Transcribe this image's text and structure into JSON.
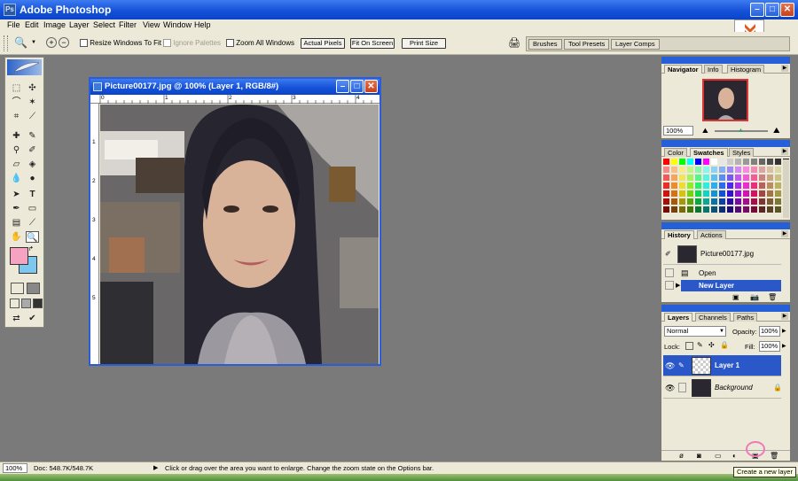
{
  "app": {
    "title": "Adobe Photoshop"
  },
  "menu": [
    "File",
    "Edit",
    "Image",
    "Layer",
    "Select",
    "Filter",
    "View",
    "Window",
    "Help"
  ],
  "options": {
    "resize_windows": "Resize Windows To Fit",
    "ignore_palettes": "Ignore Palettes",
    "zoom_all": "Zoom All Windows",
    "actual_pixels": "Actual Pixels",
    "fit_on_screen": "Fit On Screen",
    "print_size": "Print Size",
    "well_tabs": [
      "Brushes",
      "Tool Presets",
      "Layer Comps"
    ]
  },
  "document": {
    "title": "Picture00177.jpg @ 100% (Layer 1, RGB/8#)",
    "ruler_h": [
      "0",
      "1",
      "2",
      "3",
      "4"
    ],
    "ruler_v": [
      "1",
      "2",
      "3",
      "4",
      "5"
    ]
  },
  "navigator": {
    "tabs": [
      "Navigator",
      "Info",
      "Histogram"
    ],
    "zoom": "100%"
  },
  "color_panel": {
    "tabs": [
      "Color",
      "Swatches",
      "Styles"
    ]
  },
  "history": {
    "tabs": [
      "History",
      "Actions"
    ],
    "snapshot": "Picture00177.jpg",
    "items": [
      "Open",
      "New Layer"
    ]
  },
  "layers": {
    "tabs": [
      "Layers",
      "Channels",
      "Paths"
    ],
    "blend_mode": "Normal",
    "opacity_label": "Opacity:",
    "opacity": "100%",
    "lock_label": "Lock:",
    "fill_label": "Fill:",
    "fill": "100%",
    "items": [
      "Layer 1",
      "Background"
    ]
  },
  "status": {
    "zoom": "100%",
    "doc": "Doc: 548.7K/548.7K",
    "message": "Click or drag over the area you want to enlarge. Change the zoom state on the Options bar."
  },
  "tooltip": "Create a new layer",
  "colors": {
    "xp_blue": "#1552d8",
    "ui_face": "#ece9d8",
    "canvas_gray": "#7a7a7a",
    "foreground": "#f5a3c0",
    "background": "#7ec8f0",
    "selected_row": "#2b58c9"
  }
}
